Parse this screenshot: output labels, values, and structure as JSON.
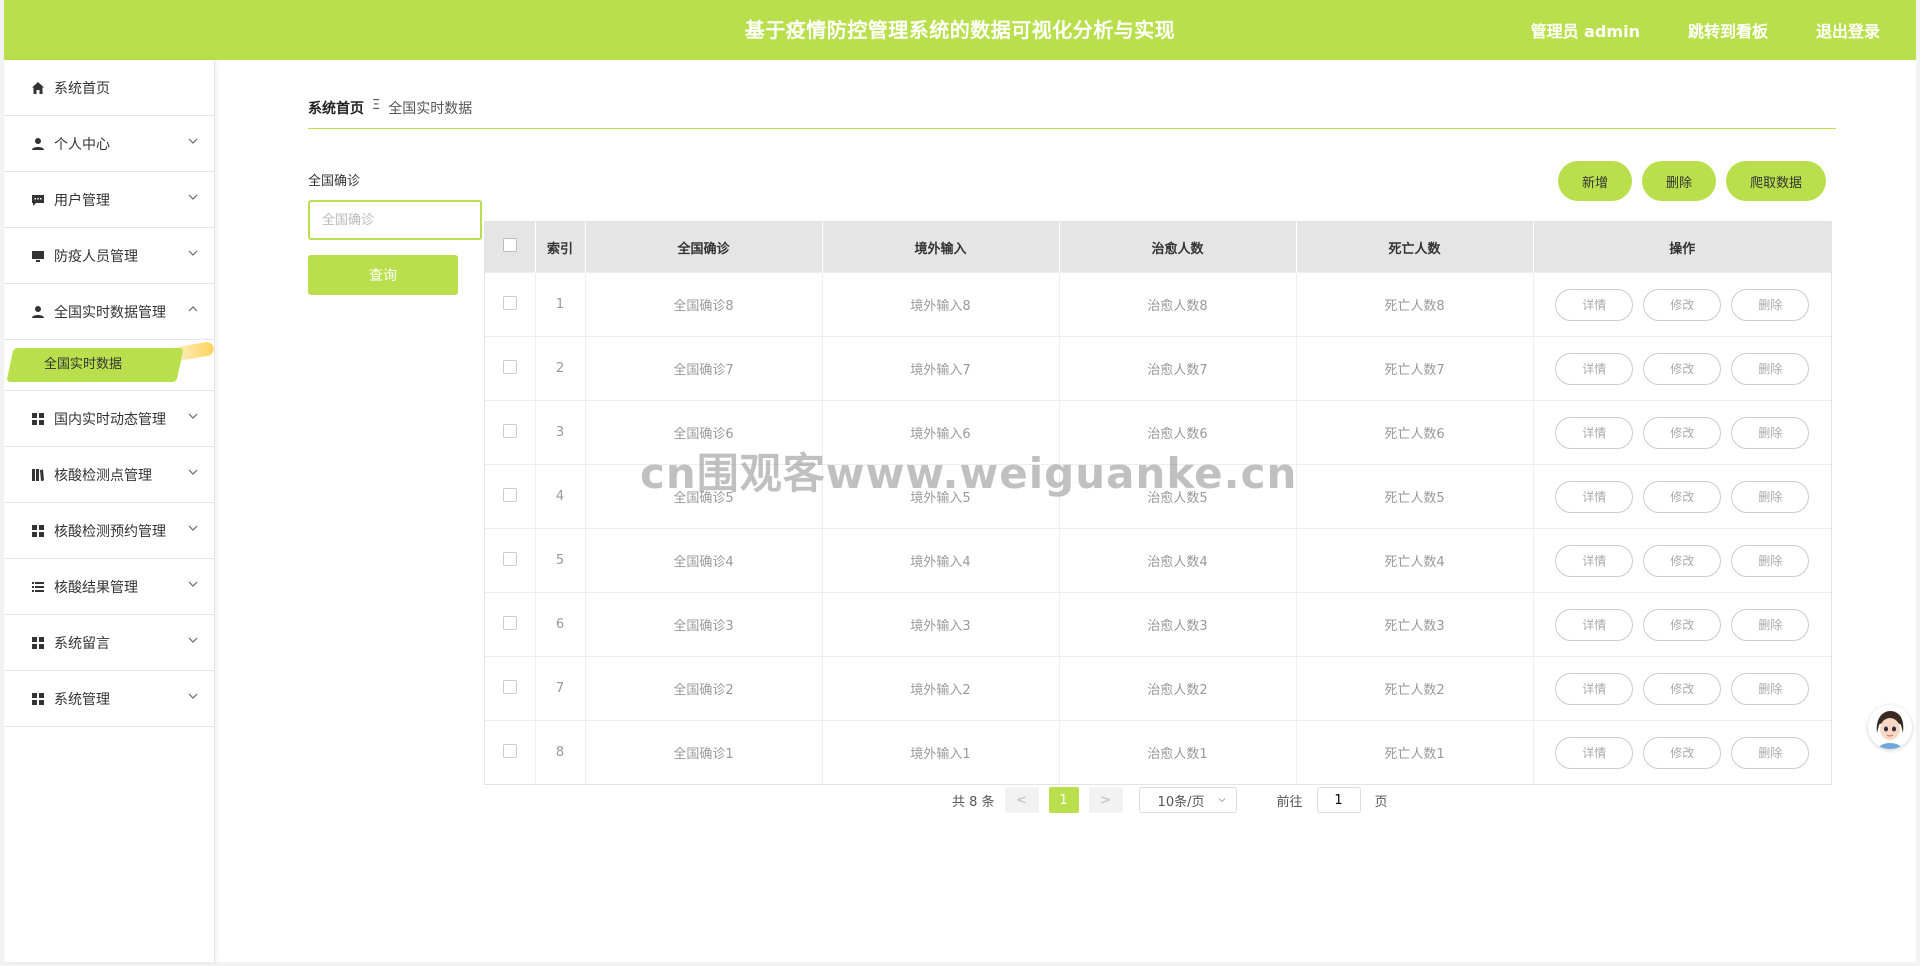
{
  "header": {
    "title": "基于疫情防控管理系统的数据可视化分析与实现",
    "nav": {
      "admin": "管理员 admin",
      "dashboard": "跳转到看板",
      "logout": "退出登录"
    }
  },
  "sidebar": {
    "items": [
      {
        "label": "系统首页",
        "icon": "home-icon"
      },
      {
        "label": "个人中心",
        "icon": "user-icon"
      },
      {
        "label": "用户管理",
        "icon": "chat-icon"
      },
      {
        "label": "防疫人员管理",
        "icon": "monitor-icon"
      },
      {
        "label": "全国实时数据管理",
        "icon": "user-icon"
      },
      {
        "label": "国内实时动态管理",
        "icon": "grid-icon"
      },
      {
        "label": "核酸检测点管理",
        "icon": "book-icon"
      },
      {
        "label": "核酸检测预约管理",
        "icon": "grid-icon"
      },
      {
        "label": "核酸结果管理",
        "icon": "list-icon"
      },
      {
        "label": "系统留言",
        "icon": "grid-icon"
      },
      {
        "label": "系统管理",
        "icon": "grid-icon"
      }
    ],
    "active_sub": "全国实时数据"
  },
  "breadcrumb": {
    "home": "系统首页",
    "sep": "Ξ",
    "current": "全国实时数据"
  },
  "search": {
    "label": "全国确诊",
    "placeholder": "全国确诊",
    "button": "查询"
  },
  "actions": {
    "add": "新增",
    "delete": "删除",
    "crawl": "爬取数据"
  },
  "table": {
    "headers": [
      "索引",
      "全国确诊",
      "境外输入",
      "治愈人数",
      "死亡人数",
      "操作"
    ],
    "rows": [
      [
        "1",
        "全国确诊8",
        "境外输入8",
        "治愈人数8",
        "死亡人数8"
      ],
      [
        "2",
        "全国确诊7",
        "境外输入7",
        "治愈人数7",
        "死亡人数7"
      ],
      [
        "3",
        "全国确诊6",
        "境外输入6",
        "治愈人数6",
        "死亡人数6"
      ],
      [
        "4",
        "全国确诊5",
        "境外输入5",
        "治愈人数5",
        "死亡人数5"
      ],
      [
        "5",
        "全国确诊4",
        "境外输入4",
        "治愈人数4",
        "死亡人数4"
      ],
      [
        "6",
        "全国确诊3",
        "境外输入3",
        "治愈人数3",
        "死亡人数3"
      ],
      [
        "7",
        "全国确诊2",
        "境外输入2",
        "治愈人数2",
        "死亡人数2"
      ],
      [
        "8",
        "全国确诊1",
        "境外输入1",
        "治愈人数1",
        "死亡人数1"
      ]
    ],
    "row_buttons": {
      "detail": "详情",
      "edit": "修改",
      "delete": "删除"
    }
  },
  "pagination": {
    "total": "共 8 条",
    "prev": "<",
    "page": "1",
    "next": ">",
    "page_size": "10条/页",
    "goto": "前往",
    "goto_value": "1",
    "page_unit": "页"
  },
  "watermark": "cn围观客www.weiguanke.cn",
  "colors": {
    "accent": "#b9e04c",
    "header_bg": "#b9e04c",
    "table_head": "#e5e5e5"
  }
}
